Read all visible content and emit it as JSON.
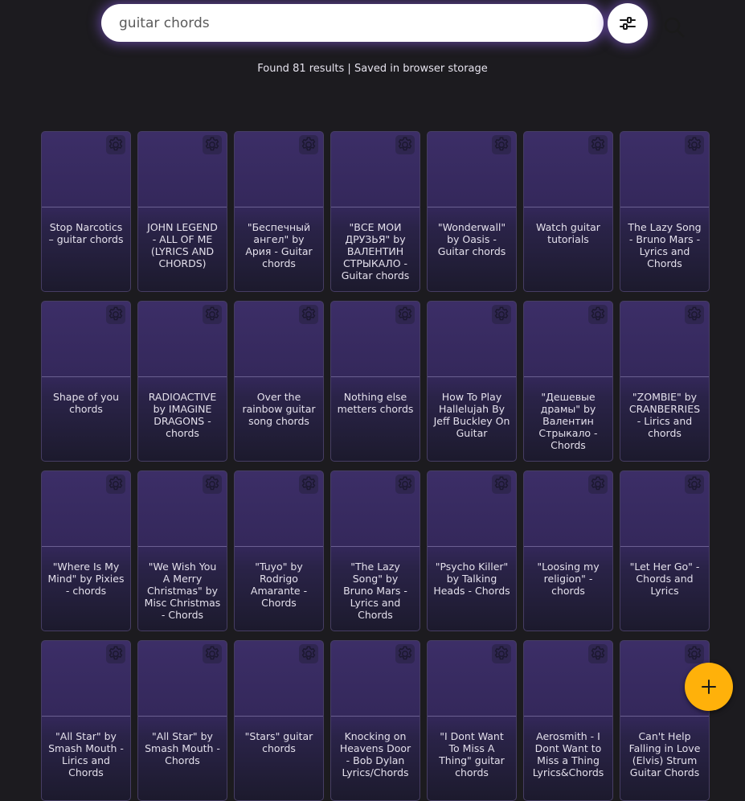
{
  "search": {
    "value": "guitar chords",
    "clear_icon": "close-icon",
    "search_icon": "search-icon",
    "filter_icon": "sliders-icon"
  },
  "status": {
    "results_text": "Found 81 results",
    "separator": " | ",
    "storage_text": "Saved in browser storage"
  },
  "colors": {
    "background": "#1c1b1f",
    "card_top": "#3c2e67",
    "card_bottom": "#1c1a2d",
    "accent_glow": "#8a5ce6",
    "fab": "#ffb10a"
  },
  "cards": [
    {
      "title": "Stop Narcotics – guitar chords"
    },
    {
      "title": "JOHN LEGEND - ALL OF ME (LYRICS AND CHORDS)"
    },
    {
      "title": "\"Беспечный ангел\" by Ария - Guitar chords"
    },
    {
      "title": "\"ВСЕ МОИ ДРУЗЬЯ\" by ВАЛЕНТИН СТРЫКАЛО - Guitar chords"
    },
    {
      "title": "\"Wonderwall\" by Oasis - Guitar chords"
    },
    {
      "title": "Watch guitar tutorials"
    },
    {
      "title": "The Lazy Song - Bruno Mars - Lyrics and Chords"
    },
    {
      "title": "Shape of you chords"
    },
    {
      "title": "RADIOACTIVE by IMAGINE DRAGONS - chords"
    },
    {
      "title": "Over the rainbow guitar song chords"
    },
    {
      "title": "Nothing else metters chords"
    },
    {
      "title": "How To Play Hallelujah By Jeff Buckley On Guitar"
    },
    {
      "title": "\"Дешевые драмы\" by Валентин Стрыкало - Chords"
    },
    {
      "title": "\"ZOMBIE\" by CRANBERRIES - Lirics and chords"
    },
    {
      "title": "\"Where Is My Mind\" by Pixies - chords"
    },
    {
      "title": "\"We Wish You A Merry Christmas\" by Misc Christmas - Chords"
    },
    {
      "title": "\"Tuyo\" by Rodrigo Amarante - Chords"
    },
    {
      "title": "\"The Lazy Song\" by Bruno Mars - Lyrics and Chords"
    },
    {
      "title": "\"Psycho Killer\" by Talking Heads - Chords"
    },
    {
      "title": "\"Loosing my religion\" - chords"
    },
    {
      "title": "\"Let Her Go\" - Chords and Lyrics"
    },
    {
      "title": "\"All Star\" by Smash Mouth - Lirics and Chords"
    },
    {
      "title": "\"All Star\" by Smash Mouth - Chords"
    },
    {
      "title": "\"Stars\" guitar chords"
    },
    {
      "title": "Knocking on Heavens Door - Bob Dylan Lyrics/Chords"
    },
    {
      "title": "\"I Dont Want To Miss A Thing\" guitar chords"
    },
    {
      "title": "Aerosmith - I Dont Want to Miss a Thing Lyrics&Chords"
    },
    {
      "title": "Can't Help Falling in Love (Elvis) Strum Guitar Chords"
    }
  ],
  "card_settings_icon": "gear-icon",
  "fab": {
    "icon": "plus-icon"
  }
}
